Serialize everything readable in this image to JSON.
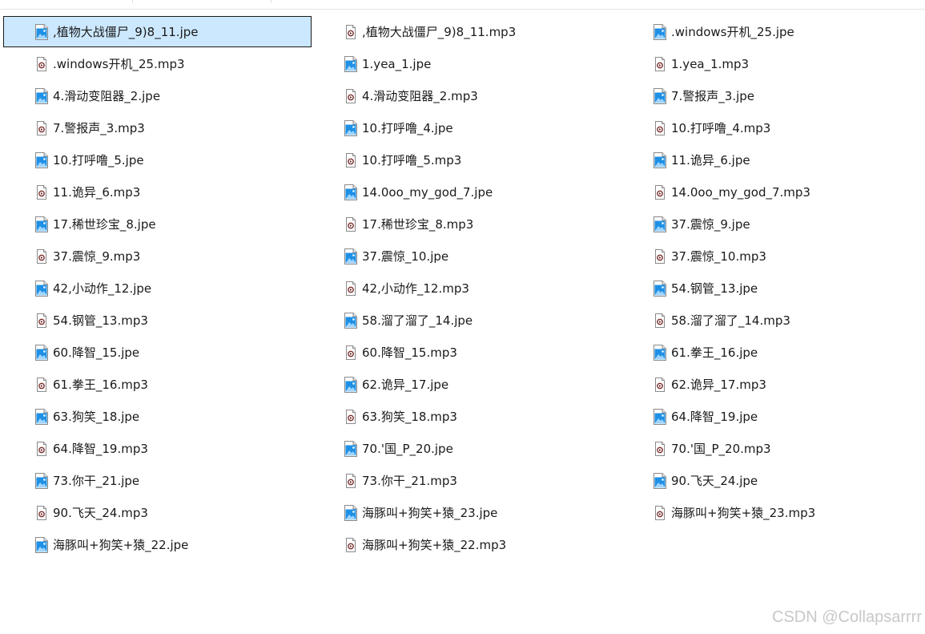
{
  "files": [
    {
      "name": ",植物大战僵尸_9)8_11.jpe",
      "type": "image",
      "selected": true
    },
    {
      "name": ",植物大战僵尸_9)8_11.mp3",
      "type": "audio"
    },
    {
      "name": ".windows开机_25.jpe",
      "type": "image"
    },
    {
      "name": ".windows开机_25.mp3",
      "type": "audio"
    },
    {
      "name": "1.yea_1.jpe",
      "type": "image"
    },
    {
      "name": "1.yea_1.mp3",
      "type": "audio"
    },
    {
      "name": "4.滑动变阻器_2.jpe",
      "type": "image"
    },
    {
      "name": "4.滑动变阻器_2.mp3",
      "type": "audio"
    },
    {
      "name": "7.警报声_3.jpe",
      "type": "image"
    },
    {
      "name": "7.警报声_3.mp3",
      "type": "audio"
    },
    {
      "name": "10.打呼噜_4.jpe",
      "type": "image"
    },
    {
      "name": "10.打呼噜_4.mp3",
      "type": "audio"
    },
    {
      "name": "10.打呼噜_5.jpe",
      "type": "image"
    },
    {
      "name": "10.打呼噜_5.mp3",
      "type": "audio"
    },
    {
      "name": "11.诡异_6.jpe",
      "type": "image"
    },
    {
      "name": "11.诡异_6.mp3",
      "type": "audio"
    },
    {
      "name": "14.0oo_my_god_7.jpe",
      "type": "image"
    },
    {
      "name": "14.0oo_my_god_7.mp3",
      "type": "audio"
    },
    {
      "name": "17.稀世珍宝_8.jpe",
      "type": "image"
    },
    {
      "name": "17.稀世珍宝_8.mp3",
      "type": "audio"
    },
    {
      "name": "37.震惊_9.jpe",
      "type": "image"
    },
    {
      "name": "37.震惊_9.mp3",
      "type": "audio"
    },
    {
      "name": "37.震惊_10.jpe",
      "type": "image"
    },
    {
      "name": "37.震惊_10.mp3",
      "type": "audio"
    },
    {
      "name": "42,小动作_12.jpe",
      "type": "image"
    },
    {
      "name": "42,小动作_12.mp3",
      "type": "audio"
    },
    {
      "name": "54.钢管_13.jpe",
      "type": "image"
    },
    {
      "name": "54.钢管_13.mp3",
      "type": "audio"
    },
    {
      "name": "58.溜了溜了_14.jpe",
      "type": "image"
    },
    {
      "name": "58.溜了溜了_14.mp3",
      "type": "audio"
    },
    {
      "name": "60.降智_15.jpe",
      "type": "image"
    },
    {
      "name": "60.降智_15.mp3",
      "type": "audio"
    },
    {
      "name": "61.拳王_16.jpe",
      "type": "image"
    },
    {
      "name": "61.拳王_16.mp3",
      "type": "audio"
    },
    {
      "name": "62.诡异_17.jpe",
      "type": "image"
    },
    {
      "name": "62.诡异_17.mp3",
      "type": "audio"
    },
    {
      "name": "63.狗笑_18.jpe",
      "type": "image"
    },
    {
      "name": "63.狗笑_18.mp3",
      "type": "audio"
    },
    {
      "name": "64.降智_19.jpe",
      "type": "image"
    },
    {
      "name": "64.降智_19.mp3",
      "type": "audio"
    },
    {
      "name": "70.'国_P_20.jpe",
      "type": "image"
    },
    {
      "name": "70.'国_P_20.mp3",
      "type": "audio"
    },
    {
      "name": "73.你干_21.jpe",
      "type": "image"
    },
    {
      "name": "73.你干_21.mp3",
      "type": "audio"
    },
    {
      "name": "90.飞天_24.jpe",
      "type": "image"
    },
    {
      "name": "90.飞天_24.mp3",
      "type": "audio"
    },
    {
      "name": "海豚叫+狗笑+猿_23.jpe",
      "type": "image"
    },
    {
      "name": "海豚叫+狗笑+猿_23.mp3",
      "type": "audio"
    },
    {
      "name": "海豚叫+狗笑+猿_22.jpe",
      "type": "image"
    },
    {
      "name": "海豚叫+狗笑+猿_22.mp3",
      "type": "audio"
    }
  ],
  "icons": {
    "image": "image-file-icon",
    "audio": "audio-file-icon"
  },
  "colors": {
    "selection_fill": "#cce8ff",
    "selection_border": "#1a1a1a",
    "image_icon_blue": "#1e90e6",
    "audio_icon_accent": "#7a2f2f"
  },
  "watermark": "CSDN @Collapsarrrr"
}
